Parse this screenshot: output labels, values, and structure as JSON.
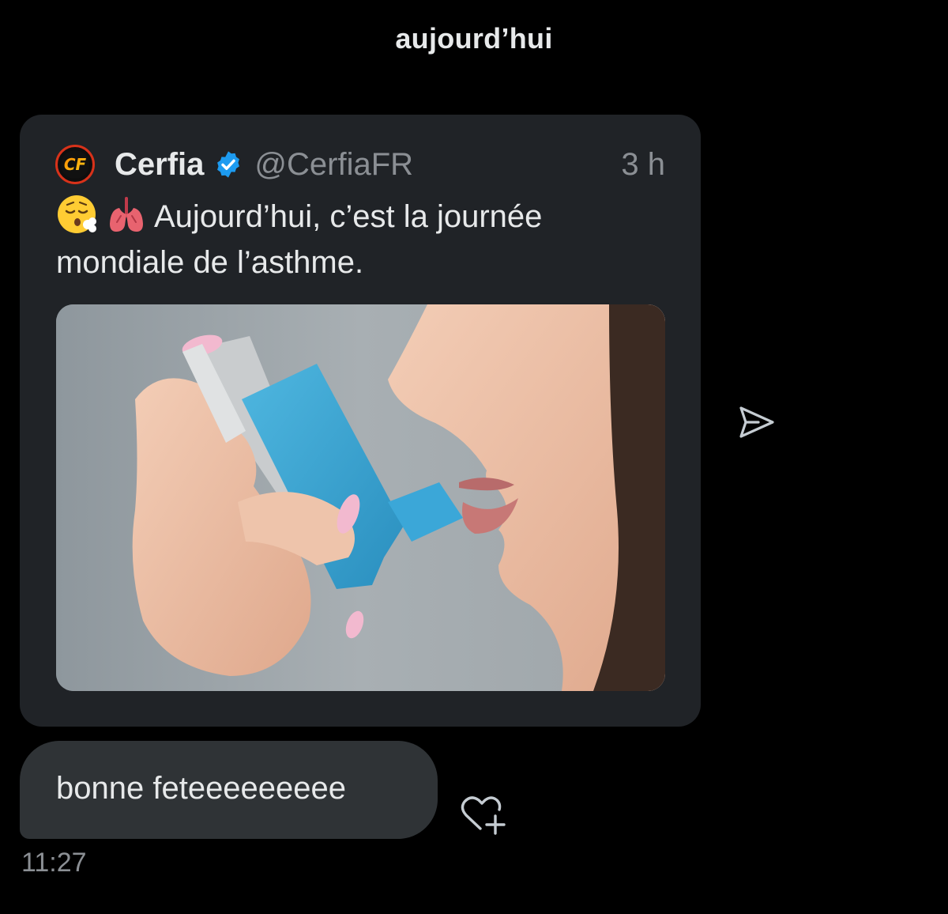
{
  "header": {
    "date_label": "aujourd’hui"
  },
  "tweet": {
    "author_name": "Cerfia",
    "author_handle": "@CerfiaFR",
    "time_ago": "3 h",
    "avatar_initials": "CF",
    "verified": true,
    "emojis": [
      "face-exhaling-emoji",
      "lungs-emoji"
    ],
    "text": "Aujourd’hui, c’est la journée mondiale de l’asthme.",
    "media_description": "asthma-inhaler-photo"
  },
  "message": {
    "text": "bonne feteeeeeeeee",
    "time": "11:27"
  },
  "colors": {
    "background": "#000000",
    "card": "#202327",
    "bubble": "#2f3336",
    "text": "#e7e9ea",
    "muted": "#8b8f94",
    "verified": "#1d9bf0",
    "inhaler": "#3aa6d6"
  }
}
